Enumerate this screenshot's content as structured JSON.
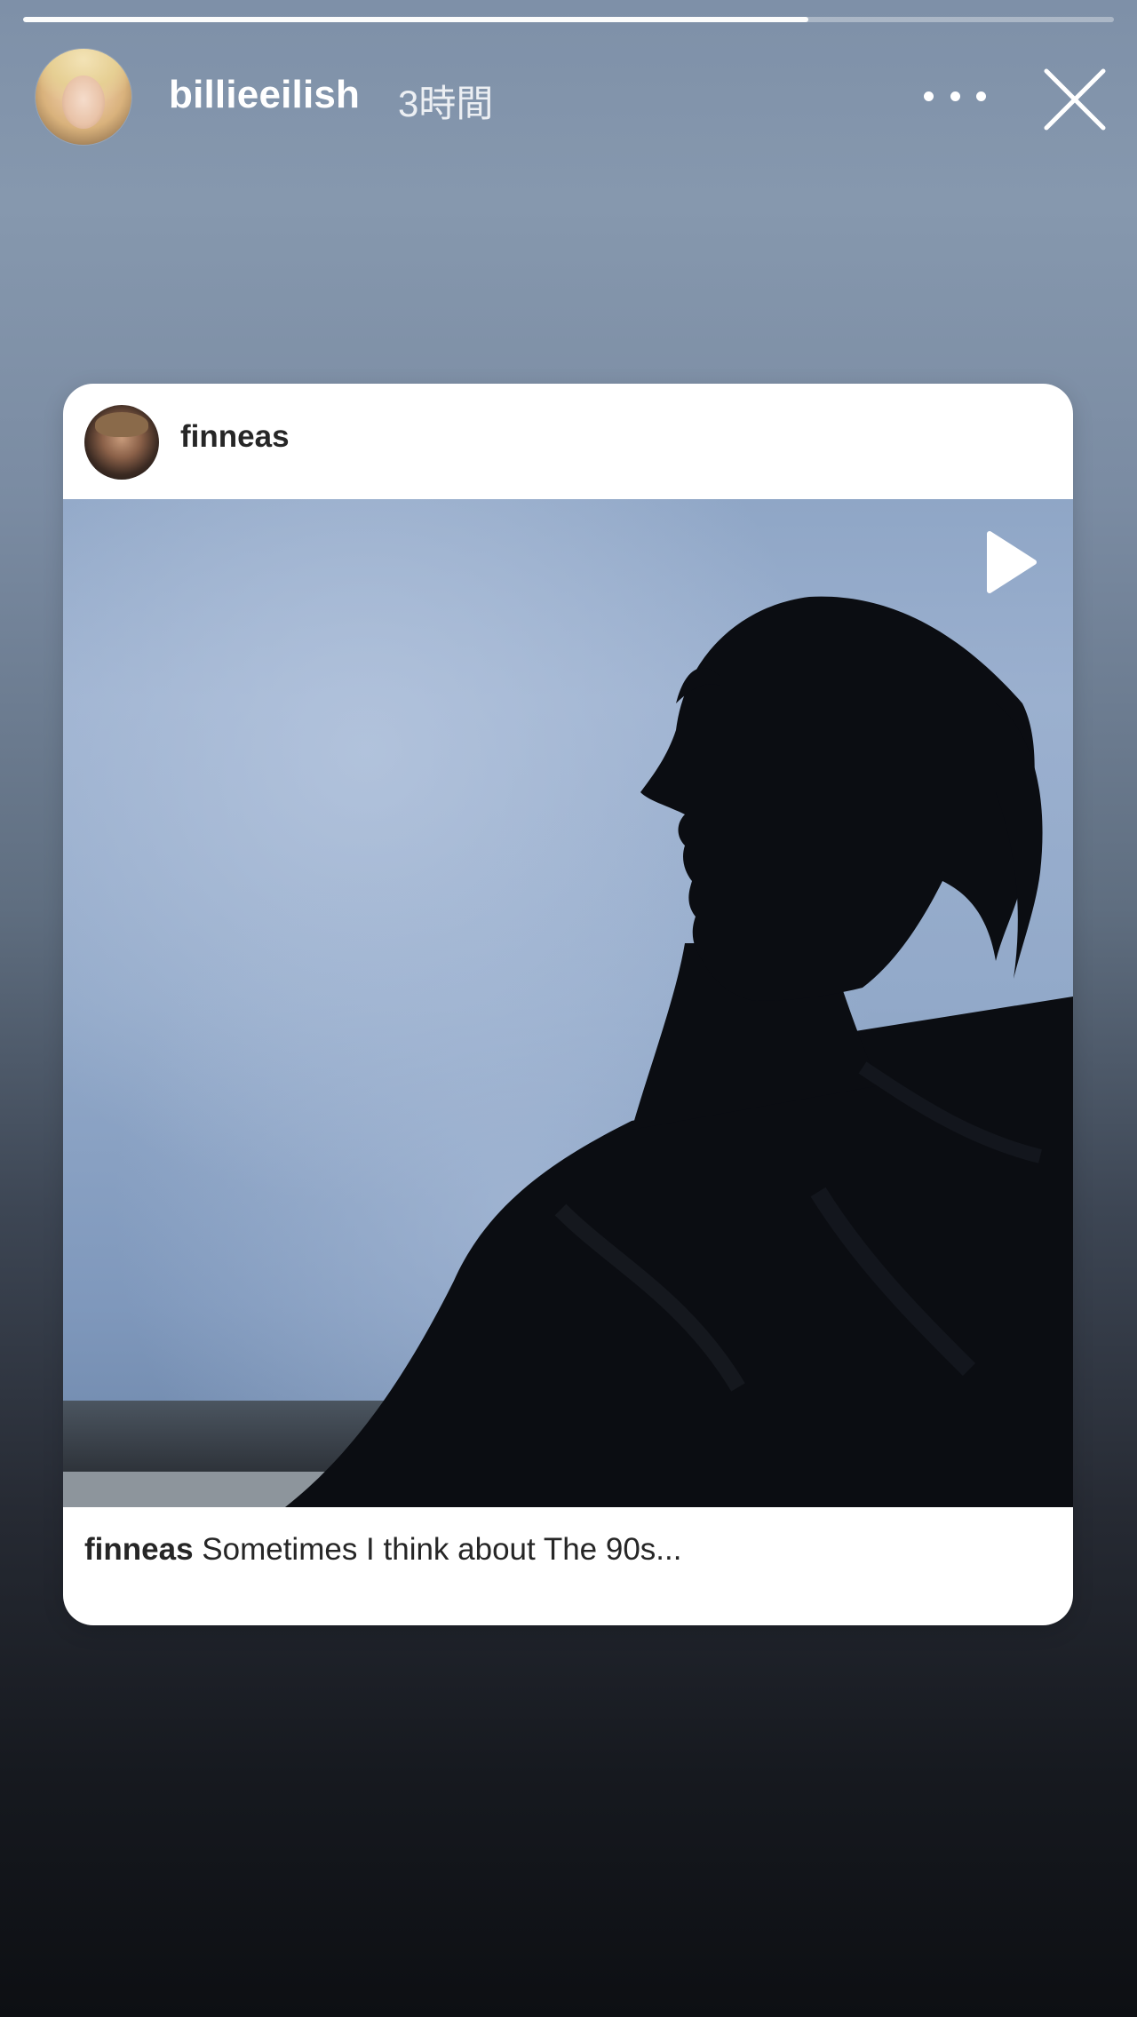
{
  "story": {
    "progress": 0.72,
    "username": "billieeilish",
    "timestamp": "3時間",
    "more_icon": "more-horizontal-icon",
    "close_icon": "close-icon"
  },
  "post": {
    "username": "finneas",
    "caption_user": "finneas",
    "caption_text": "Sometimes I think about The 90s...",
    "media_icon": "play-icon"
  },
  "colors": {
    "background_top": "#7e90a8",
    "background_bottom": "#0d0f13",
    "card": "#ffffff",
    "text": "#262626"
  }
}
